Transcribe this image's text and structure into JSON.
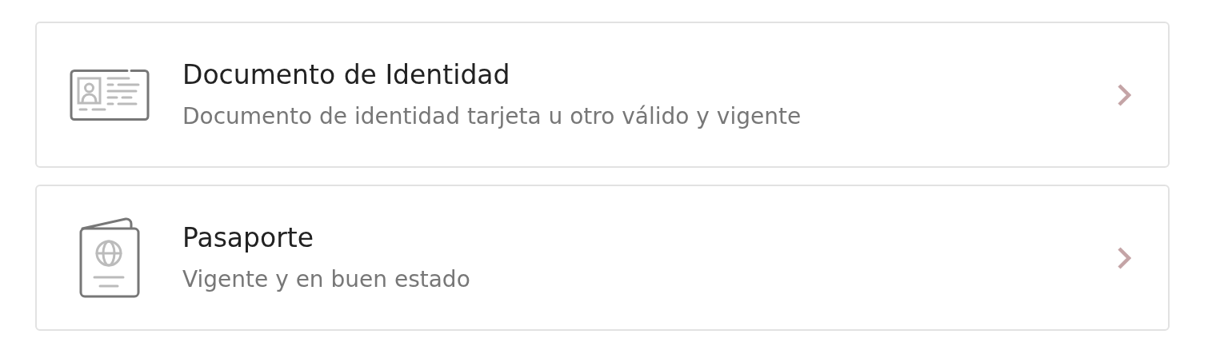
{
  "options": [
    {
      "kind": "id-card",
      "title": "Documento de Identidad",
      "subtitle": "Documento de identidad tarjeta u otro válido y vigente"
    },
    {
      "kind": "passport",
      "title": "Pasaporte",
      "subtitle": "Vigente y en buen estado"
    }
  ]
}
